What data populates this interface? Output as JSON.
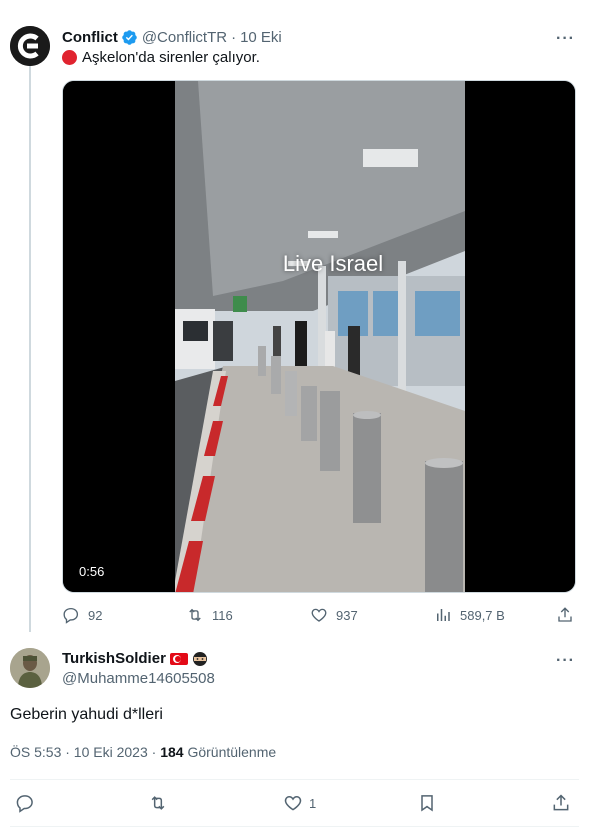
{
  "tweet": {
    "author_name": "Conflict",
    "handle": "@ConflictTR",
    "separator": "·",
    "time": "10 Eki",
    "text": "Aşkelon'da sirenler çalıyor.",
    "video": {
      "caption": "Live Israel",
      "duration": "0:56"
    },
    "stats": {
      "replies": "92",
      "retweets": "116",
      "likes": "937",
      "views": "589,7 B"
    }
  },
  "reply": {
    "author_name": "TurkishSoldier",
    "handle": "@Muhamme14605508",
    "text": "Geberin yahudi d*lleri",
    "timestamp": "ÖS 5:53 · 10 Eki 2023 ·",
    "views_count": "184",
    "views_label": "Görüntülenme",
    "stats": {
      "likes": "1"
    }
  },
  "colors": {
    "accent": "#1d9bf0",
    "muted": "#536471",
    "text": "#0f1419",
    "red_dot": "#e0232f"
  }
}
